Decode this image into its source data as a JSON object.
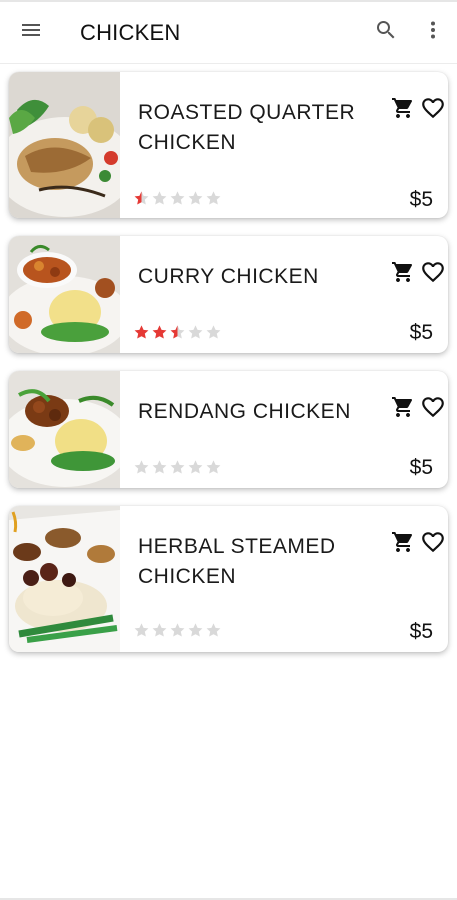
{
  "app_bar": {
    "title": "CHICKEN",
    "menu_icon": "menu-icon",
    "search_icon": "search-icon",
    "more_icon": "more-vert-icon"
  },
  "colors": {
    "star_filled": "#e53935",
    "star_empty": "#d9d9d9",
    "icon": "#111111"
  },
  "items": [
    {
      "name": "ROASTED QUARTER CHICKEN",
      "price": "$5",
      "rating": 0.5
    },
    {
      "name": "CURRY CHICKEN",
      "price": "$5",
      "rating": 2.5
    },
    {
      "name": "RENDANG CHICKEN",
      "price": "$5",
      "rating": 0
    },
    {
      "name": "HERBAL STEAMED CHICKEN",
      "price": "$5",
      "rating": 0
    }
  ]
}
